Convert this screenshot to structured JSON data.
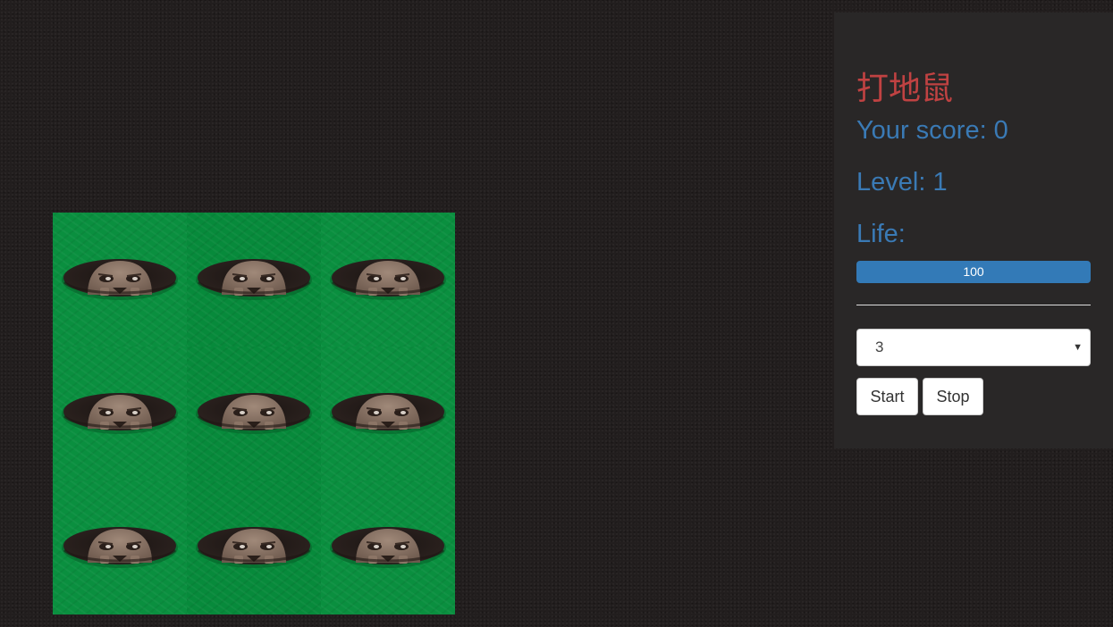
{
  "game": {
    "title": "打地鼠",
    "score_text": "Your score: 0",
    "level_text": "Level: 1",
    "life_label": "Life:",
    "life_value": 100,
    "life_text": "100",
    "level_select": {
      "selected": "3"
    },
    "buttons": {
      "start_label": "Start",
      "stop_label": "Stop"
    },
    "board": {
      "rows": 3,
      "cols": 3,
      "holes": [
        {
          "row": 1,
          "col": 1,
          "content": "mole"
        },
        {
          "row": 1,
          "col": 2,
          "content": "mole"
        },
        {
          "row": 1,
          "col": 3,
          "content": "mole"
        },
        {
          "row": 2,
          "col": 1,
          "content": "mole"
        },
        {
          "row": 2,
          "col": 2,
          "content": "mole"
        },
        {
          "row": 2,
          "col": 3,
          "content": "mole"
        },
        {
          "row": 3,
          "col": 1,
          "content": "mole"
        },
        {
          "row": 3,
          "col": 2,
          "content": "mole"
        },
        {
          "row": 3,
          "col": 3,
          "content": "mole"
        }
      ]
    }
  },
  "colors": {
    "background": "#221e1e",
    "panel": "#292727",
    "title": "#c04242",
    "stat_text": "#3a7ab5",
    "progress_bar": "#337ab7",
    "grass": "#0a8f3f"
  },
  "icons": {
    "select_caret": "caret-down-icon",
    "mole": "mole-icon"
  }
}
